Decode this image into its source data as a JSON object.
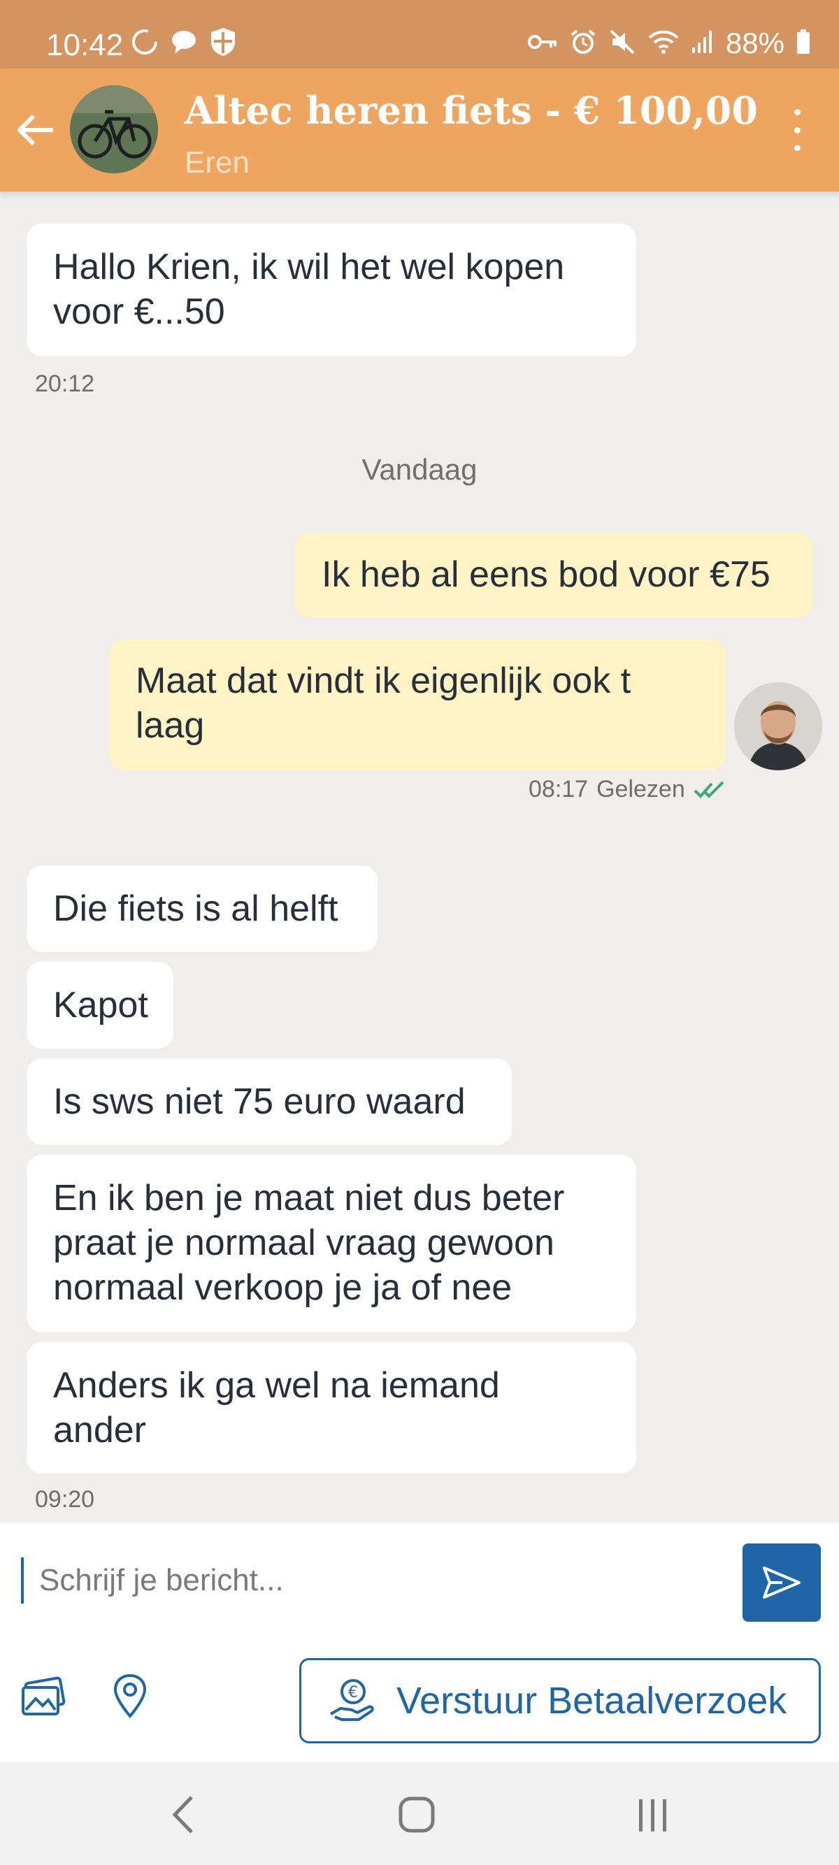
{
  "status_bar": {
    "time": "10:42",
    "battery": "88%",
    "left_icons": [
      "sync-icon",
      "chat-icon",
      "shield-icon"
    ],
    "right_icons": [
      "key-icon",
      "alarm-icon",
      "mute-icon",
      "wifi-icon",
      "signal-icon",
      "battery-icon"
    ]
  },
  "header": {
    "title": "Altec heren fiets - € 100,00",
    "subtitle": "Eren",
    "accent_color": "#eea560"
  },
  "messages": [
    {
      "side": "in",
      "text": "Hallo Krien, ik wil het wel kopen\nvoor €...50"
    },
    {
      "side": "out",
      "text": "Ik heb al eens bod voor €75"
    },
    {
      "side": "out",
      "text": "Maat dat vindt ik eigenlijk ook t\nlaag"
    },
    {
      "side": "in",
      "text": "Die fiets is al helft"
    },
    {
      "side": "in",
      "text": "Kapot"
    },
    {
      "side": "in",
      "text": "Is sws niet 75 euro waard"
    },
    {
      "side": "in",
      "text": "En ik ben je maat niet dus beter\npraat je normaal vraag gewoon\nnormaal verkoop je ja of nee"
    },
    {
      "side": "in",
      "text": "Anders ik ga wel na iemand\nander"
    }
  ],
  "timestamps": {
    "first": "20:12",
    "read_time": "08:17",
    "read_status": "Gelezen",
    "last": "09:20"
  },
  "day_separator": "Vandaag",
  "composer": {
    "placeholder": "Schrijf je bericht...",
    "send_color": "#1f66a8"
  },
  "toolbar": {
    "pay_button_label": "Verstuur Betaalverzoek"
  }
}
